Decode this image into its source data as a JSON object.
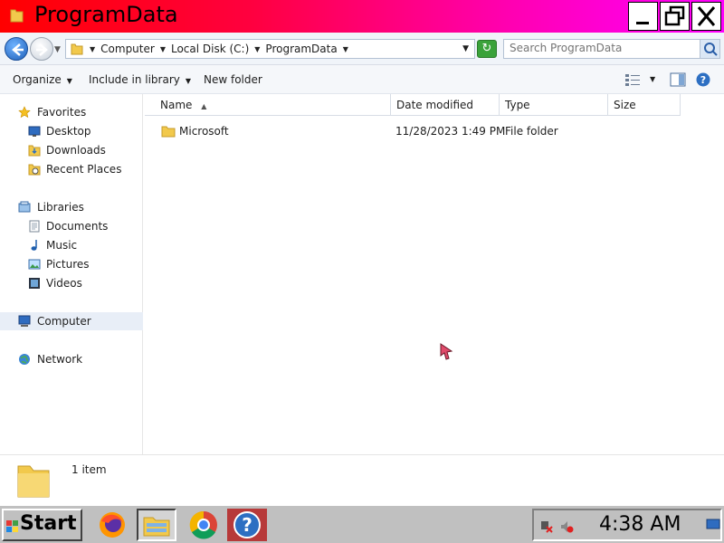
{
  "window": {
    "title": "ProgramData",
    "icon": "folder-icon"
  },
  "address": {
    "crumbs": [
      "Computer",
      "Local Disk (C:)",
      "ProgramData"
    ],
    "search_placeholder": "Search ProgramData"
  },
  "toolbar": {
    "organize": "Organize",
    "include_in_library": "Include in library",
    "new_folder": "New folder"
  },
  "nav": {
    "favorites": "Favorites",
    "desktop": "Desktop",
    "downloads": "Downloads",
    "recent_places": "Recent Places",
    "libraries": "Libraries",
    "documents": "Documents",
    "music": "Music",
    "pictures": "Pictures",
    "videos": "Videos",
    "computer": "Computer",
    "network": "Network"
  },
  "columns": {
    "name": "Name",
    "date_modified": "Date modified",
    "type": "Type",
    "size": "Size"
  },
  "files": [
    {
      "name": "Microsoft",
      "date_modified": "11/28/2023 1:49 PM",
      "type": "File folder",
      "size": ""
    }
  ],
  "details": {
    "count": "1 item"
  },
  "taskbar": {
    "start": "Start",
    "clock": "4:38 AM",
    "apps": [
      "firefox-icon",
      "file-explorer-icon",
      "chrome-icon",
      "help-icon"
    ]
  },
  "colors": {
    "title_gradient_start": "#ff0000",
    "title_gradient_end": "#ff00ff",
    "taskbar": "#c0c0c0"
  }
}
